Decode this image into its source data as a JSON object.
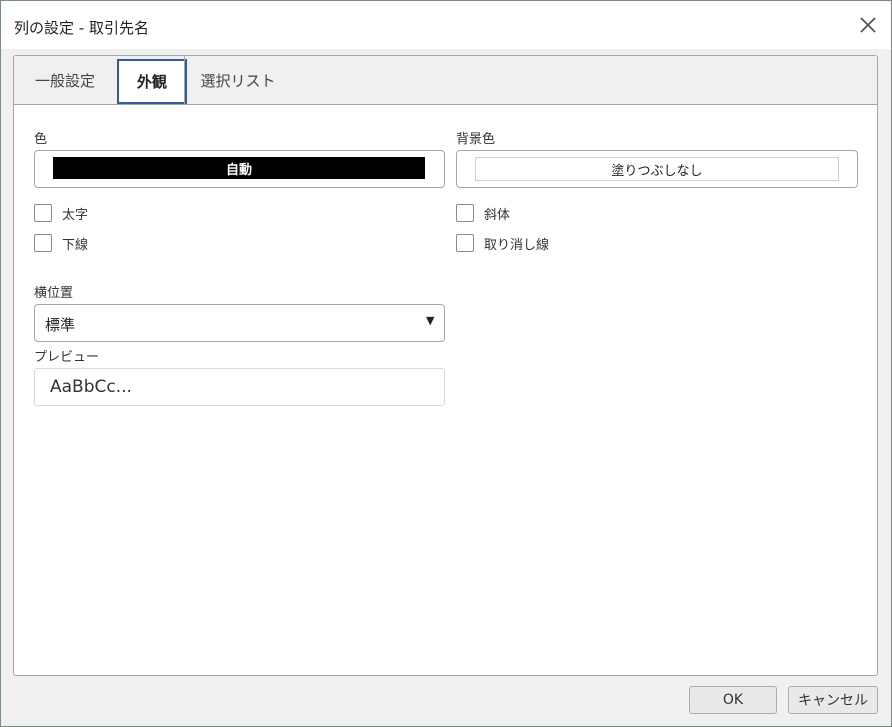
{
  "window": {
    "title": "列の設定 - 取引先名"
  },
  "tabs": [
    {
      "label": "一般設定",
      "active": false
    },
    {
      "label": "外観",
      "active": true
    },
    {
      "label": "選択リスト",
      "active": false
    }
  ],
  "appearance": {
    "color": {
      "label": "色",
      "value": "自動",
      "swatch": "#000000"
    },
    "background": {
      "label": "背景色",
      "value": "塗りつぶしなし",
      "swatch": "#ffffff"
    },
    "checkboxes": {
      "bold": {
        "label": "太字",
        "checked": false
      },
      "italic": {
        "label": "斜体",
        "checked": false
      },
      "underline": {
        "label": "下線",
        "checked": false
      },
      "strikethrough": {
        "label": "取り消し線",
        "checked": false
      }
    },
    "alignment": {
      "label": "横位置",
      "value": "標準"
    },
    "preview": {
      "label": "プレビュー",
      "text": "AaBbCc..."
    }
  },
  "buttons": {
    "ok": "OK",
    "cancel": "キャンセル"
  },
  "icons": {
    "close": "close-icon",
    "dropdown": "chevron-down-icon"
  }
}
